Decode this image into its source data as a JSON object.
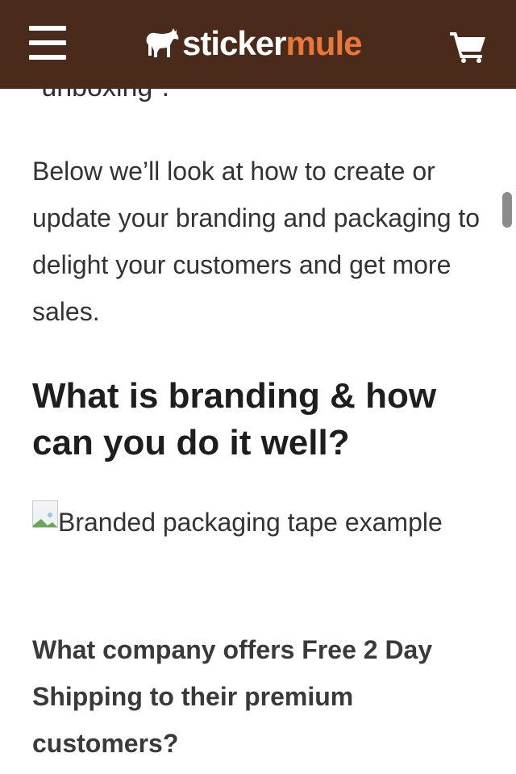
{
  "header": {
    "logo": {
      "sticker": "sticker",
      "mule": "mule"
    },
    "menu_icon": "hamburger-menu-icon",
    "cart_icon": "shopping-cart-icon",
    "colors": {
      "bar": "#4a2a1a",
      "brand_orange": "#e8773a"
    }
  },
  "article": {
    "partial_line": "“unboxing”.",
    "intro": "Below we’ll look at how to create or update your branding and packaging to delight your customers and get more sales.",
    "heading": "What is branding & how can you do it well?",
    "image_alt": "Branded packaging tape example",
    "subheading": "What company offers Free 2 Day Shipping to their premium customers?"
  }
}
